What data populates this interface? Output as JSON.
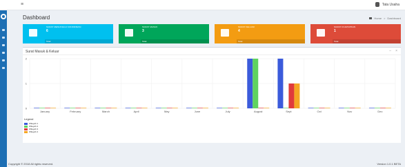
{
  "topbar": {
    "menu_icon": "hamburger-icon",
    "user_name": "Tata Usaha"
  },
  "page": {
    "title": "Dashboard",
    "breadcrumb": [
      "Home",
      "Dashboard"
    ]
  },
  "stat_boxes": [
    {
      "label": "SURAT MENUNGGU KONFIRMASI",
      "count": "6",
      "footer": "Total",
      "color": "#00c0ef",
      "icon": "user-edit-icon"
    },
    {
      "label": "SURAT MASUK",
      "count": "3",
      "footer": "Total",
      "color": "#00a65a",
      "icon": "inbox-download-icon"
    },
    {
      "label": "SURAT KELUAR",
      "count": "4",
      "footer": "Total",
      "color": "#f39c12",
      "icon": "outbox-icon"
    },
    {
      "label": "SURAT DI ARSIPKAN",
      "count": "1",
      "footer": "Total",
      "color": "#dd4b39",
      "icon": "sign-out-icon"
    }
  ],
  "chart_panel": {
    "title": "Surat Masuk & Keluar",
    "collapse_icon": "minus-icon",
    "close_icon": "times-icon"
  },
  "chart_data": {
    "type": "bar",
    "categories": [
      "January",
      "February",
      "March",
      "April",
      "May",
      "June",
      "July",
      "August",
      "Sept",
      "Oct",
      "Nov",
      "Dec"
    ],
    "series": [
      {
        "name": "Wilayah 1",
        "color": "#3b5bdb",
        "values": [
          0,
          0,
          0,
          0,
          0,
          0,
          0,
          2,
          2,
          0,
          0,
          0
        ]
      },
      {
        "name": "Wilayah 2",
        "color": "#5fd35f",
        "values": [
          0,
          0,
          0,
          0,
          0,
          0,
          0,
          2,
          0,
          0,
          0,
          0
        ]
      },
      {
        "name": "Wilayah 3",
        "color": "#e03b3b",
        "values": [
          0,
          0,
          0,
          0,
          0,
          0,
          0,
          0,
          1,
          0,
          0,
          0
        ]
      },
      {
        "name": "Wilayah 4",
        "color": "#f5a623",
        "values": [
          0,
          0,
          0,
          0,
          0,
          0,
          0,
          0,
          1,
          0,
          0,
          0
        ]
      }
    ],
    "yticks": [
      "0",
      "1",
      "2"
    ],
    "ylim": [
      0,
      2
    ],
    "grid": true,
    "legend_title": "Legend",
    "legend_position": "bottom-left"
  },
  "footer": {
    "copyright": "Copyright © 2018 All rights reserved.",
    "version": "Version 1.0.1 BETA"
  }
}
